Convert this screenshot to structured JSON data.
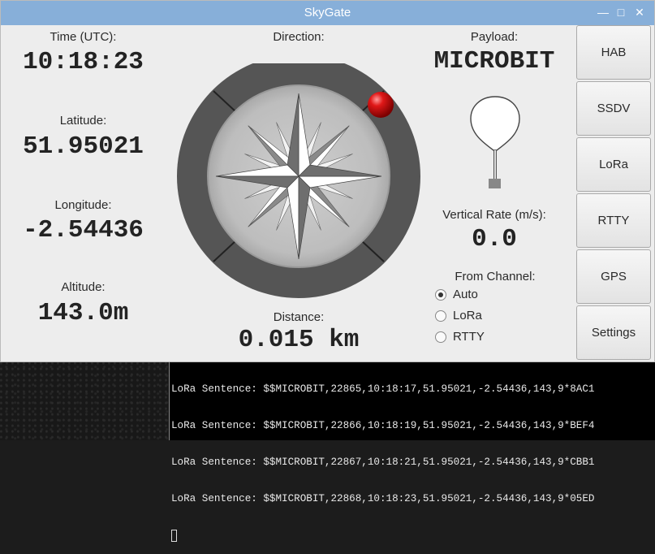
{
  "window": {
    "title": "SkyGate"
  },
  "left": {
    "time_label": "Time (UTC):",
    "time_value": "10:18:23",
    "lat_label": "Latitude:",
    "lat_value": "51.95021",
    "lon_label": "Longitude:",
    "lon_value": "-2.54436",
    "alt_label": "Altitude:",
    "alt_value": "143.0m"
  },
  "center": {
    "direction_label": "Direction:",
    "distance_label": "Distance:",
    "distance_value": "0.015 km"
  },
  "payload": {
    "label": "Payload:",
    "name": "MICROBIT",
    "vrate_label": "Vertical Rate (m/s):",
    "vrate_value": "0.0",
    "channel_label": "From Channel:",
    "channel_options": [
      "Auto",
      "LoRa",
      "RTTY"
    ],
    "channel_selected": "Auto"
  },
  "sidebar": {
    "buttons": [
      "HAB",
      "SSDV",
      "LoRa",
      "RTTY",
      "GPS",
      "Settings"
    ]
  },
  "terminal": {
    "lines": [
      "LoRa Sentence: $$MICROBIT,22865,10:18:17,51.95021,-2.54436,143,9*8AC1",
      "LoRa Sentence: $$MICROBIT,22866,10:18:19,51.95021,-2.54436,143,9*BEF4",
      "LoRa Sentence: $$MICROBIT,22867,10:18:21,51.95021,-2.54436,143,9*CBB1",
      "LoRa Sentence: $$MICROBIT,22868,10:18:23,51.95021,-2.54436,143,9*05ED"
    ]
  },
  "colors": {
    "titlebar": "#87afd9",
    "marker": "#cc1111"
  }
}
